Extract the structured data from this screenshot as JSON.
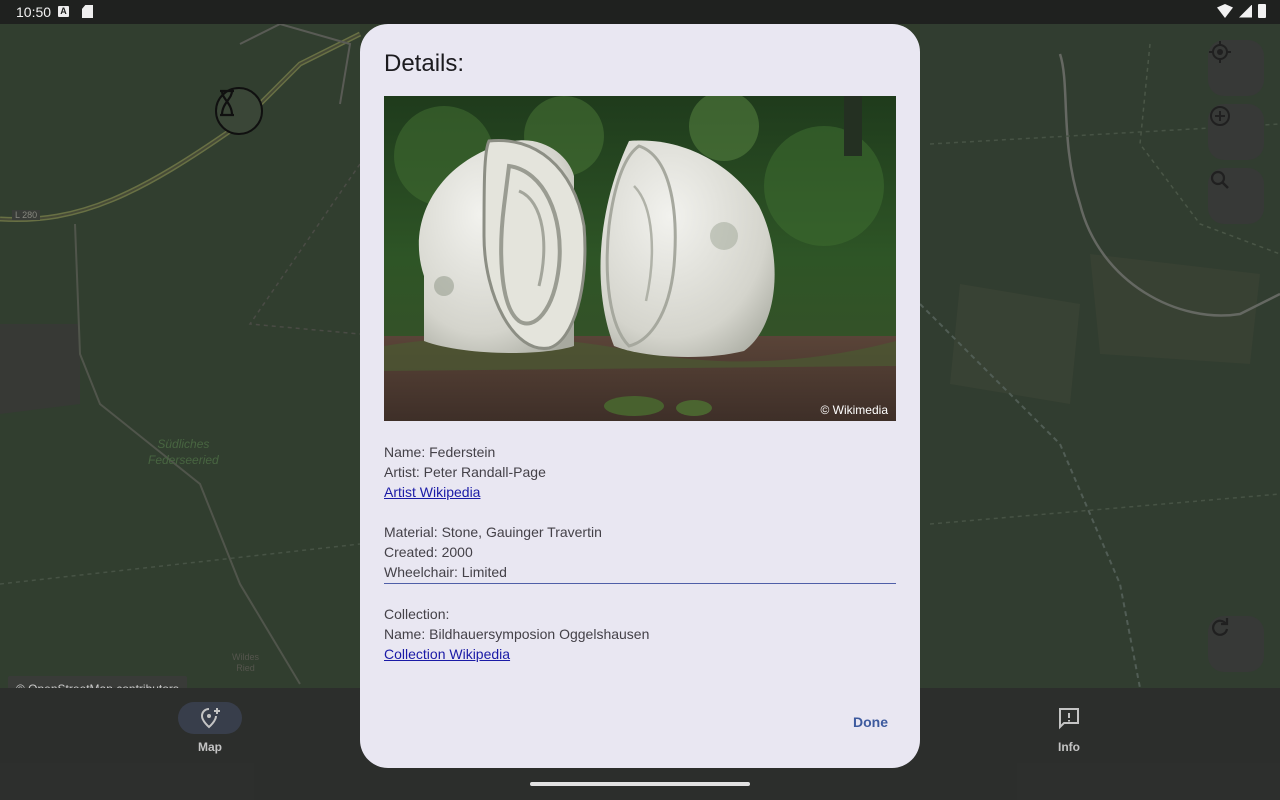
{
  "status_bar": {
    "time": "10:50",
    "icon_a": "A"
  },
  "map": {
    "labels": {
      "sudliches": "Südliches\nFederseeried",
      "wildes_ried": "Wildes\nRied",
      "road": "L 280"
    },
    "attribution": "© OpenStreetMap contributors"
  },
  "nav": [
    {
      "label": "Map",
      "icon": "add-location-icon",
      "active": true
    },
    {
      "label": "Info",
      "icon": "feedback-icon",
      "active": false
    }
  ],
  "dialog": {
    "title": "Details:",
    "photo_credit": "© Wikimedia",
    "name": "Name: Federstein",
    "artist": "Artist: Peter Randall-Page",
    "artist_link": "Artist Wikipedia",
    "material": "Material: Stone, Gauinger Travertin",
    "created": "Created: 2000",
    "wheelchair": "Wheelchair: Limited",
    "collection_heading": "Collection:",
    "collection_name": "Name: Bildhauersymposion Oggelshausen",
    "collection_link": "Collection Wikipedia",
    "done_label": "Done"
  },
  "colors": {
    "dialog_bg": "#e9e7f2",
    "link": "#1a1aa6",
    "accent": "#3d5a9e"
  }
}
